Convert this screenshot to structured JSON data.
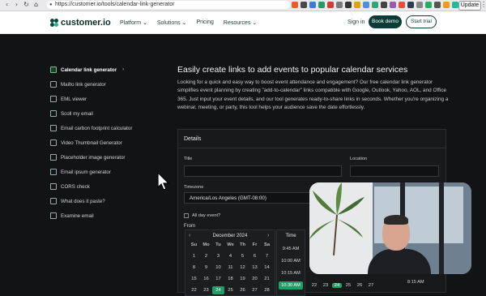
{
  "browser": {
    "url": "https://customer.io/tools/calendar-link-generator",
    "update_label": "Update",
    "nav_glyphs": [
      "‹",
      "›",
      "↻",
      "⌂"
    ],
    "more_glyph": "⋮",
    "extension_colors": [
      "#f05a28",
      "#4a4a4a",
      "#3c7bd9",
      "#1f9e69",
      "#d43c3c",
      "#7a7a7a",
      "#333333",
      "#e2a400",
      "#4a90e2",
      "#2aa876",
      "#444444",
      "#9b59b6",
      "#e74c3c",
      "#2c3e50",
      "#888888",
      "#27ae60",
      "#555555",
      "#f39c12",
      "#1abc9c",
      "#666666"
    ]
  },
  "header": {
    "logo_text": "customer.io",
    "nav": [
      "Platform ⌄",
      "Solutions ⌄",
      "Pricing",
      "Resources ⌄"
    ],
    "sign_in": "Sign in",
    "book_demo": "Book demo",
    "start_trial": "Start trial"
  },
  "sidebar": {
    "items": [
      {
        "label": "Calendar link generator",
        "active": true,
        "icon": "calendar-icon"
      },
      {
        "label": "Mailto link generator",
        "active": false,
        "icon": "mail-icon"
      },
      {
        "label": "EML viewer",
        "active": false,
        "icon": "document-icon"
      },
      {
        "label": "Scoll my email",
        "active": false,
        "icon": "scroll-icon"
      },
      {
        "label": "Email carbon footprint calculator",
        "active": false,
        "icon": "leaf-icon"
      },
      {
        "label": "Video Thumbnail Generator",
        "active": false,
        "icon": "play-icon"
      },
      {
        "label": "Placeholder image generator",
        "active": false,
        "icon": "image-icon"
      },
      {
        "label": "Email ipsum generator",
        "active": false,
        "icon": "text-icon"
      },
      {
        "label": "CORS check",
        "active": false,
        "icon": "check-icon"
      },
      {
        "label": "What does it paste?",
        "active": false,
        "icon": "clipboard-icon"
      },
      {
        "label": "Examine email",
        "active": false,
        "icon": "inspect-icon"
      }
    ],
    "active_chevron": "›"
  },
  "main": {
    "title": "Easily create links to add events to popular calendar services",
    "description": "Looking for a quick and easy way to boost event attendance and engagement? Our free calendar link generator simplifies event planning by creating \"add-to-calendar\" links compatible with Google, Outlook, Yahoo, AOL, and Office 365. Just input your event details, and our tool generates ready-to-share links in seconds. Whether you're organizing a webinar, meeting, or party, this tool helps your audience save the date effortlessly."
  },
  "form": {
    "section_title": "Details",
    "title_label": "Title",
    "location_label": "Location",
    "timezone_label": "Timezone",
    "timezone_value": "America/Los Angeles (GMT-08:00)",
    "all_day_label": "All day event?",
    "from_label": "From"
  },
  "calendar": {
    "month": "December 2024",
    "prev": "‹",
    "next": "›",
    "weekdays": [
      "Su",
      "Mo",
      "Tu",
      "We",
      "Th",
      "Fr",
      "Sa"
    ],
    "days": [
      "1",
      "2",
      "3",
      "4",
      "5",
      "6",
      "7",
      "8",
      "9",
      "10",
      "11",
      "12",
      "13",
      "14",
      "15",
      "16",
      "17",
      "18",
      "19",
      "20",
      "21",
      "22",
      "23",
      "24",
      "25",
      "26",
      "27",
      "28"
    ],
    "selected_day": "24"
  },
  "time": {
    "header": "Time",
    "items": [
      "9:45 AM",
      "10:00 AM",
      "10:15 AM",
      "10:30 AM"
    ],
    "selected": "10:30 AM"
  },
  "second_calendar": {
    "days": [
      "22",
      "23",
      "24",
      "25",
      "26",
      "27"
    ],
    "selected_day": "24",
    "time_visible": "8:15 AM"
  },
  "overlay": {
    "type": "webcam-video"
  }
}
